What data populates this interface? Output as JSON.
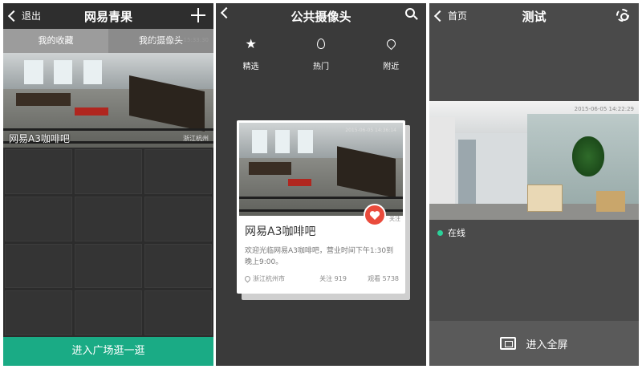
{
  "panel1": {
    "back_label": "退出",
    "title": "网易青果",
    "tabs": [
      {
        "label": "我的收藏",
        "active": true
      },
      {
        "label": "我的摄像头",
        "active": false
      }
    ],
    "feature": {
      "timestamp": "2015-06-05 15:33:30",
      "name": "网易A3咖啡吧",
      "location": "浙江杭州"
    },
    "bottom_button": "进入广场逛一逛",
    "accent_color": "#1aab85"
  },
  "panel2": {
    "title": "公共摄像头",
    "nav": [
      {
        "label": "精选",
        "icon": "star-icon"
      },
      {
        "label": "热门",
        "icon": "flame-icon"
      },
      {
        "label": "附近",
        "icon": "location-pin-icon"
      }
    ],
    "card": {
      "timestamp": "2015-06-05 14:36:14",
      "name": "网易A3咖啡吧",
      "description": "欢迎光临网易A3咖啡吧，营业时间下午1:30到晚上9:00。",
      "follow_label": "关注",
      "location": "浙江杭州市",
      "followers": "关注 919",
      "views": "观看 5738",
      "heart_color": "#ea4b3c"
    }
  },
  "panel3": {
    "back_label": "首页",
    "title": "测试",
    "camera_timestamp": "2015-06-05 14:22:29",
    "status": "在线",
    "status_color": "#2bd29a",
    "fullscreen_label": "进入全屏"
  }
}
